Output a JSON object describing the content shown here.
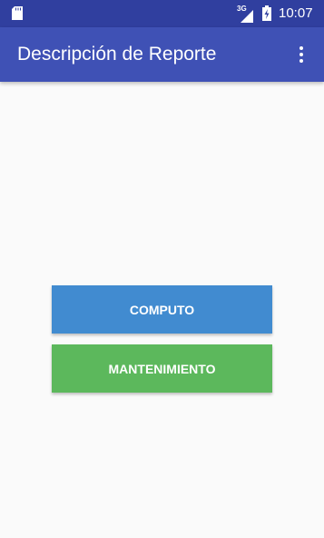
{
  "status_bar": {
    "network_type": "3G",
    "time": "10:07",
    "icons": [
      "sd-card-icon",
      "signal-icon",
      "battery-icon"
    ]
  },
  "app_bar": {
    "title": "Descripción de Reporte",
    "overflow_icon": "more-vert-icon"
  },
  "buttons": {
    "computo": {
      "label": "COMPUTO",
      "color": "#418bd0"
    },
    "mantenimiento": {
      "label": "MANTENIMIENTO",
      "color": "#5cb85c"
    }
  },
  "colors": {
    "primary": "#3f51b5",
    "primary_dark": "#303f9f",
    "background": "#fafafa"
  }
}
